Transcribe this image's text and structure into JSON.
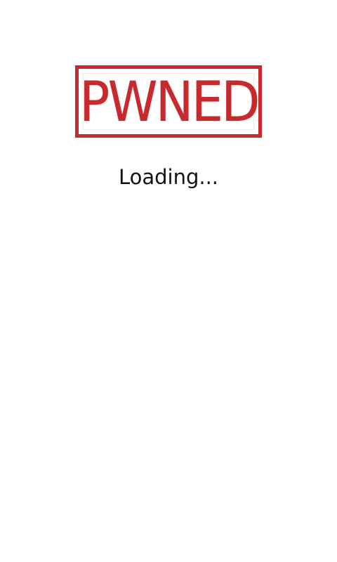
{
  "logo": {
    "text": "PWNED",
    "color": "#c62a2f"
  },
  "status": {
    "loading_label": "Loading..."
  }
}
